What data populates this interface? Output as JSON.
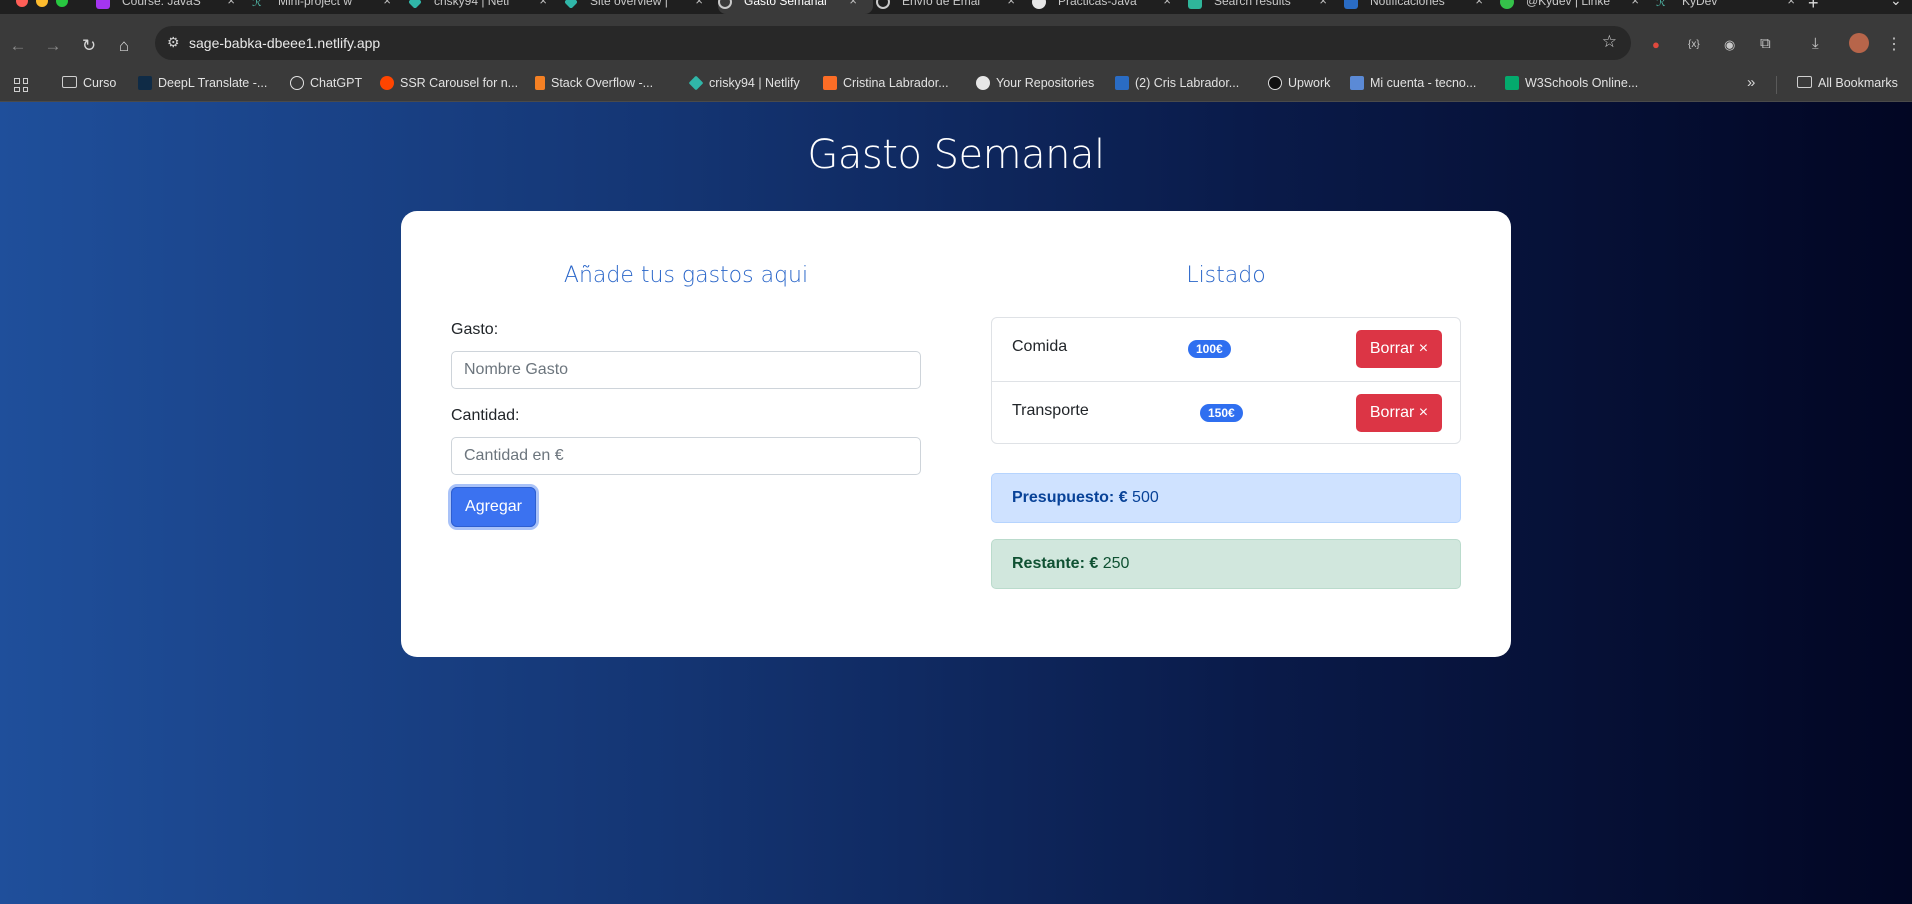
{
  "browser": {
    "tabs": [
      {
        "label": "Course: JavaS",
        "active": false
      },
      {
        "label": "Mini-project w",
        "active": false
      },
      {
        "label": "crisky94 | Netl",
        "active": false
      },
      {
        "label": "Site overview |",
        "active": false
      },
      {
        "label": "Gasto Semanal",
        "active": true
      },
      {
        "label": "Envío de Emai",
        "active": false
      },
      {
        "label": "Practicas-Java",
        "active": false
      },
      {
        "label": "Search results",
        "active": false
      },
      {
        "label": "Notificaciones",
        "active": false
      },
      {
        "label": "@Kydev | Linke",
        "active": false
      },
      {
        "label": "KyDev",
        "active": false
      }
    ],
    "url": "sage-babka-dbeee1.netlify.app",
    "bookmarks": [
      "Curso",
      "DeepL Translate -...",
      "ChatGPT",
      "SSR Carousel for n...",
      "Stack Overflow -...",
      "crisky94 | Netlify",
      "Cristina Labrador...",
      "Your Repositories",
      "(2) Cris Labrador...",
      "Upwork",
      "Mi cuenta - tecno...",
      "W3Schools Online..."
    ],
    "all_bookmarks": "All Bookmarks"
  },
  "app": {
    "title": "Gasto Semanal",
    "form": {
      "heading": "Añade tus gastos aqui",
      "gasto_label": "Gasto:",
      "gasto_placeholder": "Nombre Gasto",
      "cantidad_label": "Cantidad:",
      "cantidad_placeholder": "Cantidad en €",
      "submit_label": "Agregar"
    },
    "listado": {
      "heading": "Listado",
      "items": [
        {
          "name": "Comida",
          "amount": "100€",
          "delete_label": "Borrar ×"
        },
        {
          "name": "Transporte",
          "amount": "150€",
          "delete_label": "Borrar ×"
        }
      ]
    },
    "presupuesto": {
      "label": "Presupuesto: €",
      "value": "500"
    },
    "restante": {
      "label": "Restante: €",
      "value": "250"
    }
  },
  "colors": {
    "accent": "#3b72f0",
    "danger": "#dc3545",
    "badge": "#2f6ff0",
    "heading": "#2a66c9"
  }
}
